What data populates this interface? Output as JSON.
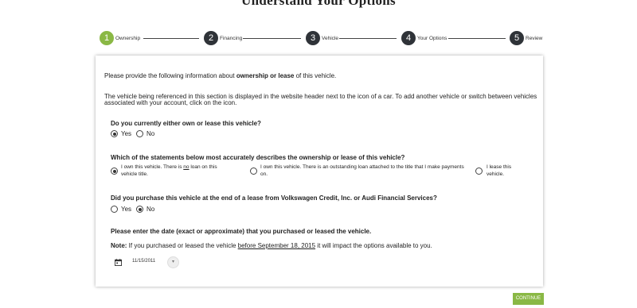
{
  "page": {
    "title": "Understand Your Options"
  },
  "stepper": [
    {
      "number": "1",
      "label": "Ownership"
    },
    {
      "number": "2",
      "label": "Financing"
    },
    {
      "number": "3",
      "label": "Vehicle"
    },
    {
      "number": "4",
      "label": "Your Options"
    },
    {
      "number": "5",
      "label": "Review"
    }
  ],
  "colors": {
    "active_step": "#8ab845",
    "inactive_step": "#2f3338",
    "button": "#8ab845"
  },
  "intro": {
    "prefix": "Please provide the following information about ",
    "bold": "ownership or lease",
    "suffix": " of this vehicle."
  },
  "info": {
    "line1": "The vehicle being referenced in this section is displayed in the website header next to the icon of a car. To add another vehicle or switch between vehicles",
    "line2": "associated with your account, click on the icon."
  },
  "q1": {
    "text": "Do you currently either own or lease this vehicle?",
    "options": [
      "Yes",
      "No"
    ],
    "selected": "Yes"
  },
  "q2": {
    "text": "Which of the statements below most accurately describes the ownership or lease of this vehicle?",
    "opt1_pre": "I own this vehicle. There is ",
    "opt1_u": "no",
    "opt1_post": " loan on this vehicle title.",
    "opt2": "I own this vehicle. There is an outstanding loan attached to the title that I make payments on.",
    "opt3": "I lease this vehicle.",
    "selected": "opt1"
  },
  "q3": {
    "text": "Did you purchase this vehicle at the end of a lease from Volkswagen Credit, Inc. or Audi Financial Services?",
    "options": [
      "Yes",
      "No"
    ],
    "selected": "No"
  },
  "q4": {
    "text": "Please enter the date (exact or approximate) that you purchased or leased the vehicle."
  },
  "note": {
    "label": "Note:",
    "pre": " If you purchased or leased the vehicle ",
    "u": "before September 18, 2015",
    "post": " it will impact the options available to you."
  },
  "date": {
    "value": "11/15/2011",
    "icon": "calendar-icon",
    "button_icon": "chevron-down-icon"
  },
  "footer": {
    "continue_label": "CONTINUE"
  }
}
